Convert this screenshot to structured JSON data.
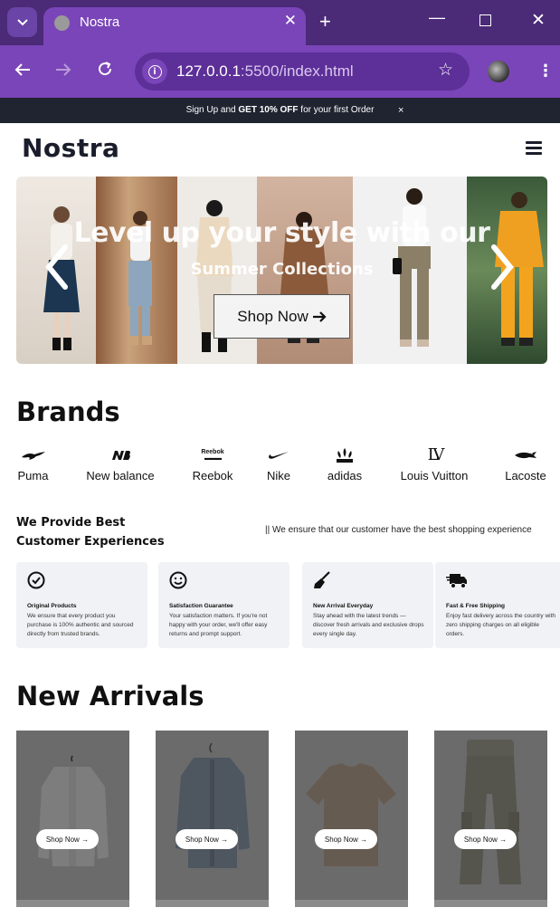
{
  "browser": {
    "tab_title": "Nostra",
    "url_host": "127.0.0.1",
    "url_rest": ":5500/index.html"
  },
  "announcement": {
    "prefix": "Sign Up and ",
    "highlight": "GET 10% OFF",
    "suffix": " for your first Order",
    "close": "×"
  },
  "header": {
    "logo": "Nostra"
  },
  "hero": {
    "title": "Level up your style with our",
    "subtitle": "Summer Collections",
    "button": "Shop Now",
    "button_icon": "arrow-right-icon"
  },
  "brands": {
    "title": "Brands",
    "items": [
      {
        "name": "Puma",
        "icon": "puma-logo-icon"
      },
      {
        "name": "New balance",
        "icon": "new-balance-logo-icon"
      },
      {
        "name": "Reebok",
        "icon": "reebok-logo-icon"
      },
      {
        "name": "Nike",
        "icon": "nike-swoosh-icon"
      },
      {
        "name": "adidas",
        "icon": "adidas-logo-icon"
      },
      {
        "name": "Louis Vuitton",
        "icon": "louis-vuitton-logo-icon"
      },
      {
        "name": "Lacoste",
        "icon": "lacoste-logo-icon"
      }
    ],
    "logo_text": {
      "reebok": "Reebok",
      "lv": "LV"
    }
  },
  "experience": {
    "title_line1": "We Provide Best",
    "title_line2": "Customer Experiences",
    "subtitle": "|| We ensure that our customer have the best shopping experience",
    "cards": [
      {
        "title": "Original Products",
        "text": "We ensure that every product you purchase is 100% authentic and sourced directly from trusted brands.",
        "icon": "check-circle-icon"
      },
      {
        "title": "Satisfaction Guarantee",
        "text": "Your satisfaction matters. If you're not happy with your order, we'll offer easy returns and prompt support.",
        "icon": "smiley-icon"
      },
      {
        "title": "New Arrival Everyday",
        "text": "Stay ahead with the latest trends — discover fresh arrivals and exclusive drops every single day.",
        "icon": "broom-icon"
      },
      {
        "title": "Fast & Free Shipping",
        "text": "Enjoy fast delivery across the country with zero shipping charges on all eligible orders.",
        "icon": "truck-icon"
      }
    ]
  },
  "arrivals": {
    "title": "New Arrivals",
    "button_label": "Shop Now",
    "products": [
      {
        "image": "white-shirt"
      },
      {
        "image": "denim-shirt"
      },
      {
        "image": "beige-tshirt"
      },
      {
        "image": "cargo-pants"
      }
    ]
  },
  "colors": {
    "chrome_dark": "#4b2a78",
    "chrome_light": "#7a45b8",
    "announcement_bg": "#1f2430",
    "card_bg": "#f1f2f5",
    "product_overlay": "#6b6b6b"
  }
}
